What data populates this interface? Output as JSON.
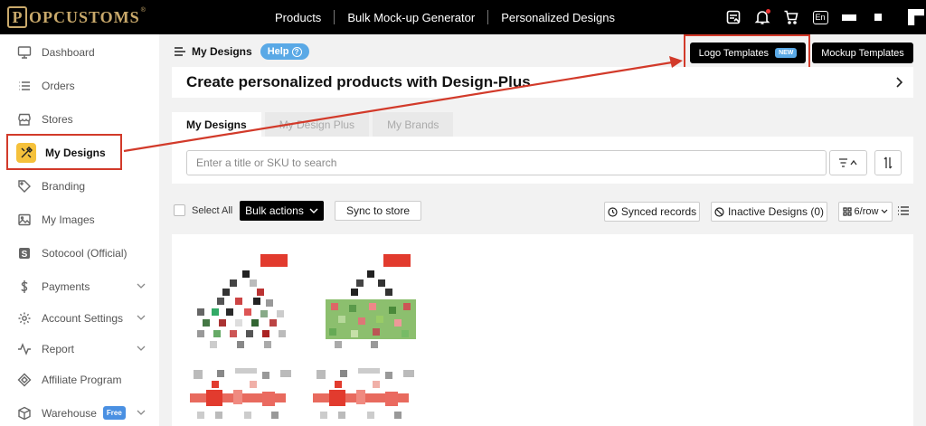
{
  "brand": {
    "logo_mark": "P",
    "name": "OPCUSTOMS",
    "reg": "®"
  },
  "topnav": {
    "items": [
      "Products",
      "Bulk Mock-up Generator",
      "Personalized Designs"
    ]
  },
  "topicons": {
    "icons": [
      "clipboard-icon",
      "bell-icon",
      "cart-icon",
      "language-icon"
    ],
    "lang_label": "En",
    "bell_dot_color": "#e33333"
  },
  "sidebar": {
    "items": [
      {
        "label": "Dashboard",
        "icon": "monitor-icon"
      },
      {
        "label": "Orders",
        "icon": "list-icon"
      },
      {
        "label": "Stores",
        "icon": "store-icon"
      },
      {
        "label": "My Designs",
        "icon": "design-tools-icon",
        "active": true
      },
      {
        "label": "Branding",
        "icon": "tag-icon"
      },
      {
        "label": "My Images",
        "icon": "image-icon"
      },
      {
        "label": "Sotocool (Official)",
        "icon": "s-logo-icon"
      },
      {
        "label": "Payments",
        "icon": "dollar-icon",
        "expandable": true
      },
      {
        "label": "Account Settings",
        "icon": "gear-icon",
        "expandable": true
      },
      {
        "label": "Report",
        "icon": "pulse-icon",
        "expandable": true
      },
      {
        "label": "Affiliate Program",
        "icon": "diamond-icon"
      },
      {
        "label": "Warehouse",
        "icon": "box-icon",
        "badge": "Free",
        "expandable": true
      }
    ],
    "active_icon_bg": "#f5c13b",
    "highlight_color": "#d23a2a"
  },
  "page": {
    "title": "My Designs",
    "help_label": "Help",
    "logo_templates_label": "Logo Templates",
    "new_badge": "NEW",
    "mockup_templates_label": "Mockup Templates"
  },
  "banner": {
    "title": "Create personalized products with Design-Plus"
  },
  "tabs": [
    "My Designs",
    "My Design Plus",
    "My Brands"
  ],
  "search": {
    "placeholder": "Enter a title or SKU to search"
  },
  "toolbar": {
    "select_all": "Select All",
    "bulk_actions": "Bulk actions",
    "sync_to_store": "Sync to store",
    "synced_records": "Synced records",
    "inactive_designs": "Inactive Designs (0)",
    "per_row": "6/row"
  },
  "accent": {
    "help": "#5aa9e6",
    "annotation": "#d23a2a"
  }
}
